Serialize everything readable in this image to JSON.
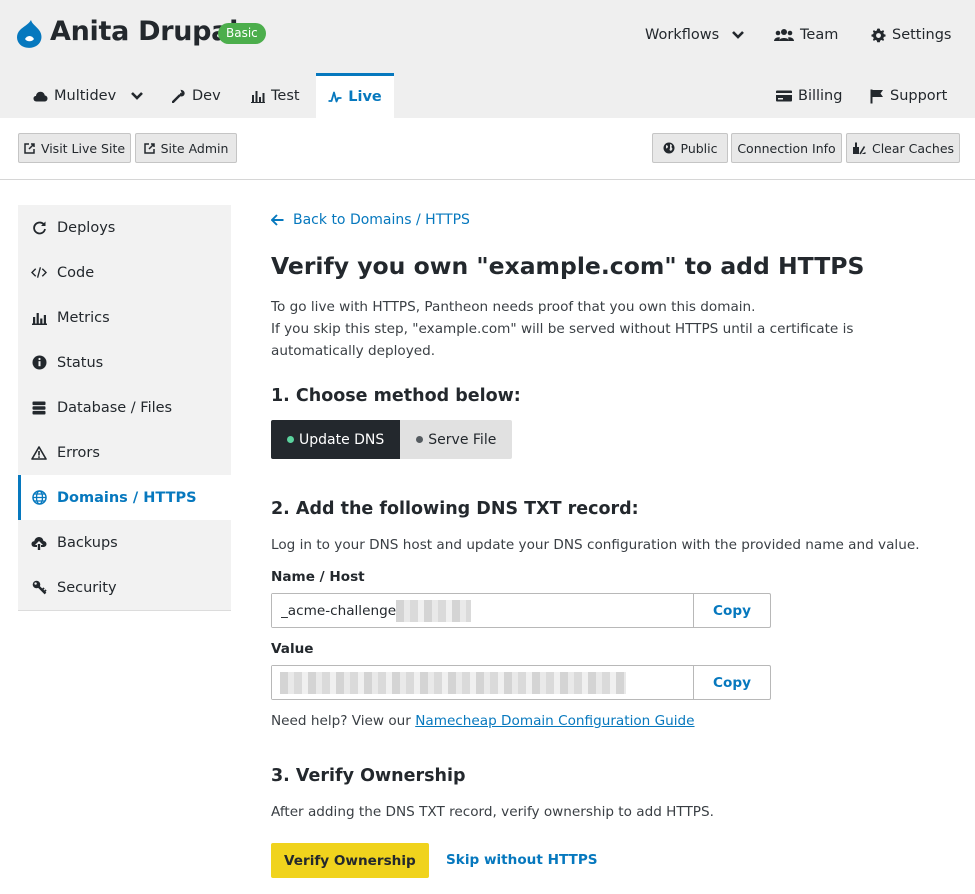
{
  "header": {
    "site_name": "Anita Drupal",
    "plan_badge": "Basic",
    "nav": {
      "workflows": "Workflows",
      "team": "Team",
      "settings": "Settings"
    }
  },
  "tabs": {
    "multidev": "Multidev",
    "dev": "Dev",
    "test": "Test",
    "live": "Live",
    "billing": "Billing",
    "support": "Support",
    "active": "live"
  },
  "actions": {
    "visit_live_site": "Visit Live Site",
    "site_admin": "Site Admin",
    "public": "Public",
    "connection_info": "Connection Info",
    "clear_caches": "Clear Caches"
  },
  "sidebar": {
    "items": [
      {
        "label": "Deploys",
        "icon": "refresh-icon"
      },
      {
        "label": "Code",
        "icon": "code-icon"
      },
      {
        "label": "Metrics",
        "icon": "bar-chart-icon"
      },
      {
        "label": "Status",
        "icon": "info-icon"
      },
      {
        "label": "Database / Files",
        "icon": "database-icon"
      },
      {
        "label": "Errors",
        "icon": "warning-icon"
      },
      {
        "label": "Domains / HTTPS",
        "icon": "globe-icon"
      },
      {
        "label": "Backups",
        "icon": "cloud-upload-icon"
      },
      {
        "label": "Security",
        "icon": "key-icon"
      }
    ],
    "active_index": 6
  },
  "main": {
    "back_link": "Back to Domains / HTTPS",
    "title": "Verify you own \"example.com\" to add HTTPS",
    "intro_line1": "To go live with HTTPS, Pantheon needs proof that you own this domain.",
    "intro_line2": "If you skip this step, \"example.com\" will be served without HTTPS until a certificate is automatically deployed.",
    "step1_heading": "1. Choose method below:",
    "method_update_dns": "Update DNS",
    "method_serve_file": "Serve File",
    "method_selected": "Update DNS",
    "step2_heading": "2. Add the following DNS TXT record:",
    "step2_text": "Log in to your DNS host and update your DNS configuration with the provided name and value.",
    "name_label": "Name / Host",
    "name_value": "_acme-challenge.",
    "value_label": "Value",
    "value_value": "",
    "copy_label": "Copy",
    "help_prefix": "Need help? View our ",
    "help_link": "Namecheap Domain Configuration Guide",
    "step3_heading": "3. Verify Ownership",
    "step3_text": "After adding the DNS TXT record, verify ownership to add HTTPS.",
    "verify_button": "Verify Ownership",
    "skip_link": "Skip without HTTPS"
  },
  "colors": {
    "accent": "#0678be",
    "badge_green": "#4cae4c",
    "verify_yellow": "#f0d31d",
    "dark": "#23282d"
  }
}
